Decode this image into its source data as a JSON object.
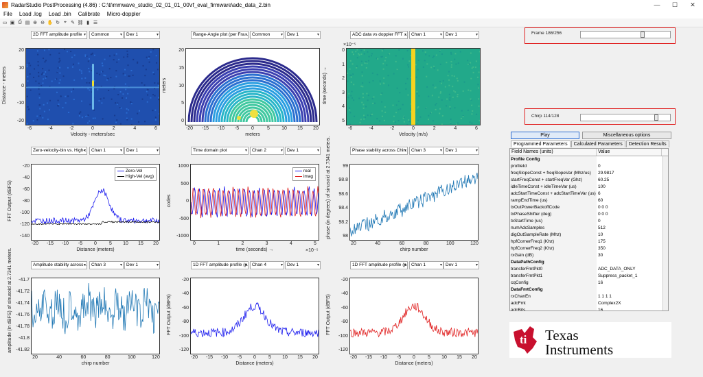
{
  "window": {
    "title": "RadarStudio PostProcessing (4.86) : C:\\ti\\mmwave_studio_02_01_01_00\\rf_eval_firmware\\adc_data_2.bin",
    "minimize": "—",
    "maximize": "☐",
    "close": "✕"
  },
  "menu": [
    "File",
    "Load .log",
    "Load .bin",
    "Calibrate",
    "Micro-doppler"
  ],
  "toolbar_icons": [
    "new-file-icon",
    "save-icon",
    "print-icon",
    "open-icon",
    "zoom-in-icon",
    "zoom-out-icon",
    "pan-icon",
    "rotate-icon",
    "data-cursor-icon",
    "brush-icon",
    "link-icon",
    "insert-colorbar-icon",
    "insert-legend-icon"
  ],
  "dropdowns": [
    {
      "id": "p1a",
      "v": "2D FFT amplitude profile"
    },
    {
      "id": "p1b",
      "v": "Common"
    },
    {
      "id": "p1c",
      "v": "Dev 1"
    },
    {
      "id": "p2a",
      "v": "Range-Angle plot (per Fra..."
    },
    {
      "id": "p2b",
      "v": "Common"
    },
    {
      "id": "p2c",
      "v": "Dev 1"
    },
    {
      "id": "p3a",
      "v": "ADC data vs doppler FFT ..."
    },
    {
      "id": "p3b",
      "v": "Chan 1"
    },
    {
      "id": "p3c",
      "v": "Dev 1"
    },
    {
      "id": "p4a",
      "v": "Zero-velocity-bin vs. High-..."
    },
    {
      "id": "p4b",
      "v": "Chan 1"
    },
    {
      "id": "p4c",
      "v": "Dev 1"
    },
    {
      "id": "p5a",
      "v": "Time domain plot"
    },
    {
      "id": "p5b",
      "v": "Chan 2"
    },
    {
      "id": "p5c",
      "v": "Dev 1"
    },
    {
      "id": "p6a",
      "v": "Phase stability across Chir..."
    },
    {
      "id": "p6b",
      "v": "Chan 3"
    },
    {
      "id": "p6c",
      "v": "Dev 1"
    },
    {
      "id": "p7a",
      "v": "Amplitude stability across ..."
    },
    {
      "id": "p7b",
      "v": "Chan 3"
    },
    {
      "id": "p7c",
      "v": "Dev 1"
    },
    {
      "id": "p8a",
      "v": "1D FFT amplitude profile (p..."
    },
    {
      "id": "p8b",
      "v": "Chan 4"
    },
    {
      "id": "p8c",
      "v": "Dev 1"
    },
    {
      "id": "p9a",
      "v": "1D FFT amplitude profile (p..."
    },
    {
      "id": "p9b",
      "v": "Chan 1"
    },
    {
      "id": "p9c",
      "v": "Dev 1"
    }
  ],
  "frame": {
    "label": "Frame 186/256",
    "current": 186,
    "total": 256
  },
  "chirp": {
    "label": "Chirp 114/128",
    "current": 114,
    "total": 128
  },
  "play_label": "Play",
  "misc_label": "Miscellaneous options",
  "tabs": [
    "Programmed Parameters",
    "Calculated Parameters",
    "Detection Results"
  ],
  "table": {
    "headers": [
      "Field Names     (units)",
      "Value"
    ],
    "rows": [
      [
        "Profile Config",
        "",
        true
      ],
      [
        "profileId",
        "0"
      ],
      [
        "freqSlopeConst + freqSlopeVar (Mhz/us)",
        "29.9817"
      ],
      [
        "startFreqConst + startFreqVar (Ghz)",
        "60.25"
      ],
      [
        "idleTimeConst + idleTimeVar (us)",
        "100"
      ],
      [
        "adcStartTimeConst + adcStartTimeVar (us)",
        "6"
      ],
      [
        "rampEndTime (us)",
        "60"
      ],
      [
        "txOutPowerBackoffCode",
        "0 0 0"
      ],
      [
        "txPhaseShifter (deg)",
        "0 0 0"
      ],
      [
        "txStartTime (us)",
        "0"
      ],
      [
        "numAdcSamples",
        "512"
      ],
      [
        "digOutSampleRate (Mhz)",
        "10"
      ],
      [
        "hpfCornerFreq1 (Khz)",
        "175"
      ],
      [
        "hpfCornerFreq2 (Khz)",
        "350"
      ],
      [
        "rxGain (dB)",
        "30"
      ],
      [
        "DataPathConfig",
        "",
        true
      ],
      [
        "transferFmtPkt0",
        "ADC_DATA_ONLY"
      ],
      [
        "transferFmtPkt1",
        "Suppress_packet_1"
      ],
      [
        "cqConfig",
        "16"
      ],
      [
        "DataFmtConfig",
        "",
        true
      ],
      [
        "rxChanEn",
        "1 1 1 1"
      ],
      [
        "adcFmt",
        "Complex2X"
      ],
      [
        "adcBits",
        "16"
      ]
    ]
  },
  "logo": {
    "line1": "Texas",
    "line2": "Instruments"
  },
  "plots": {
    "p1": {
      "ylabel": "Distance - meters",
      "xlabel": "Velocity - meters/sec",
      "xticks": [
        "-6",
        "-4",
        "-2",
        "0",
        "2",
        "4",
        "6"
      ],
      "yticks": [
        "20",
        "10",
        "0",
        "-10",
        "-20"
      ]
    },
    "p2": {
      "ylabel": "meters",
      "xlabel": "meters",
      "xticks": [
        "-20",
        "-15",
        "-10",
        "-5",
        "0",
        "5",
        "10",
        "15",
        "20"
      ],
      "yticks": [
        "20",
        "15",
        "10",
        "5",
        "0"
      ]
    },
    "p3": {
      "ylabel": "time (seconds) →",
      "xlabel": "Velocity (m/s)",
      "xticks": [
        "-6",
        "-4",
        "-2",
        "0",
        "2",
        "4",
        "6"
      ],
      "yticks": [
        "0",
        "1",
        "2",
        "3",
        "4",
        "5"
      ],
      "exp": "×10⁻⁵"
    },
    "p4": {
      "ylabel": "FFT Output (dBFS)",
      "xlabel": "Distance (meters)",
      "xticks": [
        "-20",
        "-15",
        "-10",
        "-5",
        "0",
        "5",
        "10",
        "15",
        "20"
      ],
      "yticks": [
        "-20",
        "-40",
        "-60",
        "-80",
        "-100",
        "-120",
        "-140"
      ],
      "legend": [
        "Zero-Vel",
        "High-Vel (avg)"
      ]
    },
    "p5": {
      "ylabel": "codes",
      "xlabel": "time  (seconds) →",
      "xticks": [
        "0",
        "1",
        "2",
        "3",
        "4",
        "5"
      ],
      "yticks": [
        "1000",
        "500",
        "0",
        "-500",
        "-1000"
      ],
      "legend": [
        "real",
        "imag"
      ],
      "exp": "×10⁻⁵"
    },
    "p6": {
      "ylabel": "phase (in degrees) of sinusoid at 2.7341 meters.",
      "xlabel": "chirp number",
      "xticks": [
        "20",
        "40",
        "60",
        "80",
        "100",
        "120"
      ],
      "yticks": [
        "99",
        "98.8",
        "98.6",
        "98.4",
        "98.2",
        "98"
      ]
    },
    "p7": {
      "ylabel": "amplitude (in dBFS) of sinusoid at 2.7341 meters.",
      "xlabel": "chirp number",
      "xticks": [
        "20",
        "40",
        "60",
        "80",
        "100",
        "120"
      ],
      "yticks": [
        "-41.7",
        "-41.72",
        "-41.74",
        "-41.76",
        "-41.78",
        "-41.8",
        "-41.82"
      ]
    },
    "p8": {
      "ylabel": "FFT Output (dBFS)",
      "xlabel": "Distance (meters)",
      "xticks": [
        "-20",
        "-15",
        "-10",
        "-5",
        "0",
        "5",
        "10",
        "15",
        "20"
      ],
      "yticks": [
        "-20",
        "-40",
        "-60",
        "-80",
        "-100",
        "-120"
      ]
    },
    "p9": {
      "ylabel": "FFT Output (dBFS)",
      "xlabel": "Distance (meters)",
      "xticks": [
        "-20",
        "-15",
        "-10",
        "-5",
        "0",
        "5",
        "10",
        "15",
        "20"
      ],
      "yticks": [
        "-20",
        "-40",
        "-60",
        "-80",
        "-100",
        "-120"
      ]
    }
  },
  "colors": {
    "blue": "#1a1aee",
    "red": "#e02020",
    "black": "#111",
    "matlab_blue": "#1f77b4"
  }
}
